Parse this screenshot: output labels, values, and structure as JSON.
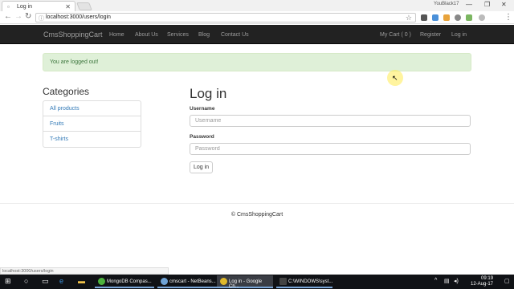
{
  "browser": {
    "tab_title": "Log in",
    "tab_favicon": "page-icon",
    "profile_name": "YouBlack17",
    "url": "localhost:3000/users/login",
    "status_url": "localhost:3000/users/login"
  },
  "navbar": {
    "brand": "CmsShoppingCart",
    "links": [
      "Home",
      "About Us",
      "Services",
      "Blog",
      "Contact Us"
    ],
    "cart": "My Cart ( 0 )",
    "register": "Register",
    "login": "Log in"
  },
  "alert": {
    "message": "You are logged out!",
    "color": "#dff0d8"
  },
  "categories": {
    "title": "Categories",
    "items": [
      "All products",
      "Fruits",
      "T-shirts"
    ]
  },
  "login": {
    "title": "Log in",
    "username_label": "Username",
    "username_placeholder": "Username",
    "password_label": "Password",
    "password_placeholder": "Password",
    "submit": "Log in"
  },
  "footer": {
    "text": "© CmsShoppingCart"
  },
  "taskbar": {
    "tasks": [
      {
        "label": "MongoDB Compas...",
        "icon_color": "#4db33d",
        "active": false
      },
      {
        "label": "cmscart - NetBeans...",
        "icon_color": "#6fa3d6",
        "active": false
      },
      {
        "label": "Log in - Google Ch...",
        "icon_color": "#e0b92b",
        "active": true
      },
      {
        "label": "C:\\WINDOWS\\syst...",
        "icon_color": "#444",
        "active": false
      }
    ],
    "time": "09:19",
    "date": "12-Aug-17"
  }
}
